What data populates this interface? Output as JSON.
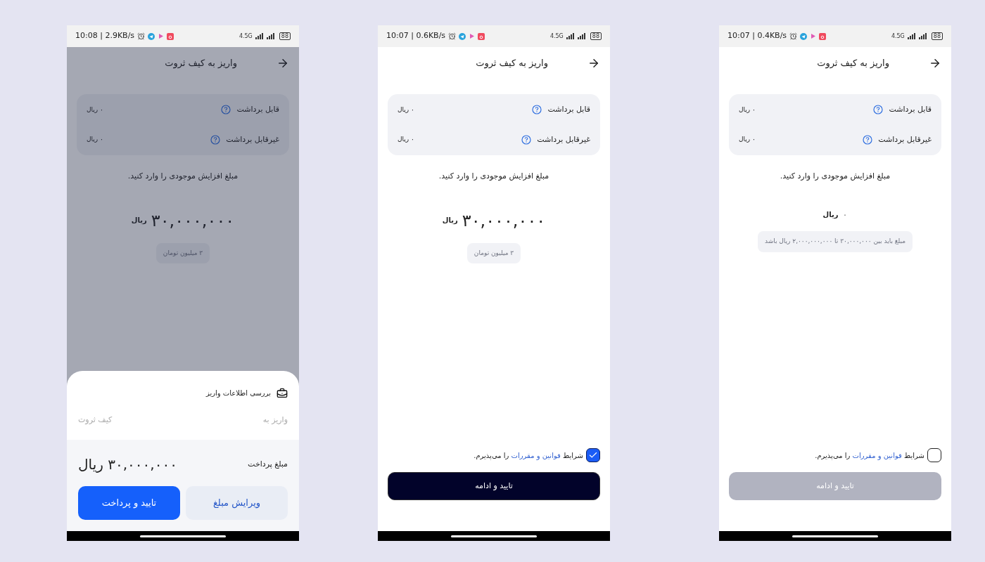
{
  "phones": [
    {
      "status_bar": {
        "time": "10:07 | 0.4KB/s",
        "network": "4.5G",
        "battery": "88"
      },
      "dimmed": false,
      "header": {
        "title": "واریز به کیف ثروت"
      },
      "balances": [
        {
          "label": "قابل برداشت",
          "value": "۰ ریال"
        },
        {
          "label": "غیرقابل برداشت",
          "value": "۰ ریال"
        }
      ],
      "prompt": "مبلغ افزایش موجودی را وارد کنید.",
      "amount": {
        "value": "۰",
        "unit": "ریال",
        "empty": true
      },
      "hint": "مبلغ باید بین ۳۰,۰۰۰,۰۰۰ تا ۲,۰۰۰,۰۰۰,۰۰۰ ریال باشد",
      "terms": {
        "checked": false,
        "prefix": "شرایط",
        "link": "قوانین و مقررات",
        "suffix": "را می‌پذیرم."
      },
      "continue_button": {
        "label": "تایید و ادامه",
        "disabled": true
      }
    },
    {
      "status_bar": {
        "time": "10:07 | 0.6KB/s",
        "network": "4.5G",
        "battery": "88"
      },
      "dimmed": false,
      "header": {
        "title": "واریز به کیف ثروت"
      },
      "balances": [
        {
          "label": "قابل برداشت",
          "value": "۰ ریال"
        },
        {
          "label": "غیرقابل برداشت",
          "value": "۰ ریال"
        }
      ],
      "prompt": "مبلغ افزایش موجودی را وارد کنید.",
      "amount": {
        "value": "۳۰,۰۰۰,۰۰۰",
        "unit": "ریال",
        "empty": false
      },
      "hint": "۳ میلیون تومان",
      "terms": {
        "checked": true,
        "prefix": "شرایط",
        "link": "قوانین و مقررات",
        "suffix": "را می‌پذیرم."
      },
      "continue_button": {
        "label": "تایید و ادامه",
        "disabled": false
      }
    },
    {
      "status_bar": {
        "time": "10:08 | 2.9KB/s",
        "network": "4.5G",
        "battery": "88"
      },
      "dimmed": true,
      "header": {
        "title": "واریز به کیف ثروت"
      },
      "balances": [
        {
          "label": "قابل برداشت",
          "value": "۰ ریال"
        },
        {
          "label": "غیرقابل برداشت",
          "value": "۰ ریال"
        }
      ],
      "prompt": "مبلغ افزایش موجودی را وارد کنید.",
      "amount": {
        "value": "۳۰,۰۰۰,۰۰۰",
        "unit": "ریال",
        "empty": false
      },
      "hint": "۳ میلیون تومان",
      "sheet": {
        "title": "بررسی اطلاعات واریز",
        "rows": [
          {
            "label": "واریز به",
            "value": "کیف ثروت"
          }
        ],
        "total_label": "مبلغ پرداخت",
        "total_value": "۳۰,۰۰۰,۰۰۰ ریال",
        "buttons": [
          {
            "label": "ویرایش مبلغ",
            "kind": "secondary"
          },
          {
            "label": "تایید و پرداخت",
            "kind": "primary"
          }
        ]
      }
    }
  ]
}
